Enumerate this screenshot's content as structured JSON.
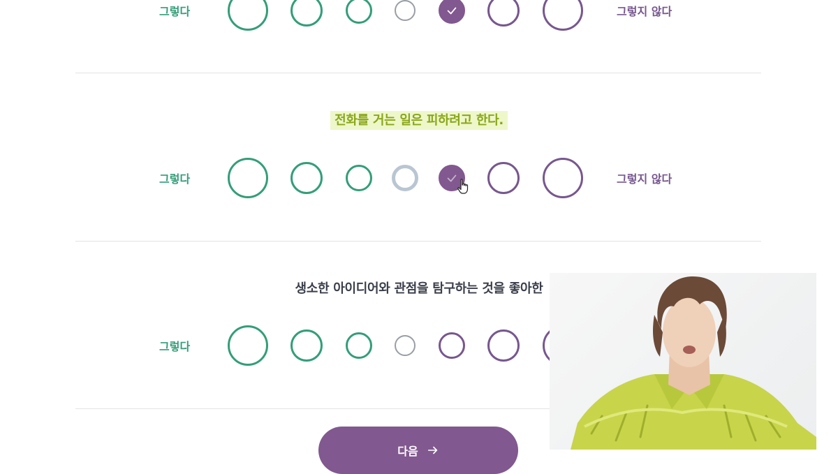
{
  "scale": {
    "agree_label": "그렇다",
    "disagree_label": "그렇지 않다"
  },
  "questions": [
    {
      "text": "",
      "selected_option": 5
    },
    {
      "text": "전화를 거는 일은 피하려고 한다.",
      "selected_option": 5,
      "highlighted": true
    },
    {
      "text": "생소한 아이디어와 관점을 탐구하는 것을 좋아한",
      "selected_option": null
    }
  ],
  "next_button": {
    "label": "다음"
  },
  "colors": {
    "agree_green": "#339e78",
    "disagree_purple": "#77578f",
    "selected_fill": "#81588f",
    "neutral_gray": "#999ea5",
    "highlight_bg": "#eef7c9",
    "highlight_text": "#8aa61a"
  },
  "icons": {
    "check": "check-icon",
    "arrow": "arrow-right-icon",
    "cursor": "hand-pointer-icon"
  }
}
